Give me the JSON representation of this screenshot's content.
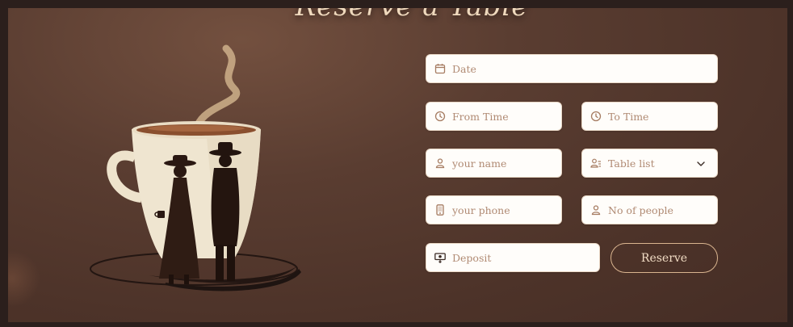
{
  "page": {
    "title": "Reserve a Table"
  },
  "form": {
    "date": {
      "placeholder": "Date",
      "icon": "calendar-icon"
    },
    "from_time": {
      "placeholder": "From Time",
      "icon": "clock-icon"
    },
    "to_time": {
      "placeholder": "To Time",
      "icon": "clock-icon"
    },
    "name": {
      "placeholder": "your name",
      "icon": "user-icon"
    },
    "table_list": {
      "selected": "Table list",
      "icon": "user-list-icon"
    },
    "phone": {
      "placeholder": "your phone",
      "icon": "phone-icon"
    },
    "people": {
      "placeholder": "No of people",
      "icon": "user-icon"
    },
    "deposit": {
      "placeholder": "Deposit",
      "icon": "money-icon"
    },
    "reserve_label": "Reserve"
  },
  "colors": {
    "background": "#4d3329",
    "accent": "#d9b48f",
    "icon": "#a67c62",
    "placeholder": "#b08a73"
  }
}
